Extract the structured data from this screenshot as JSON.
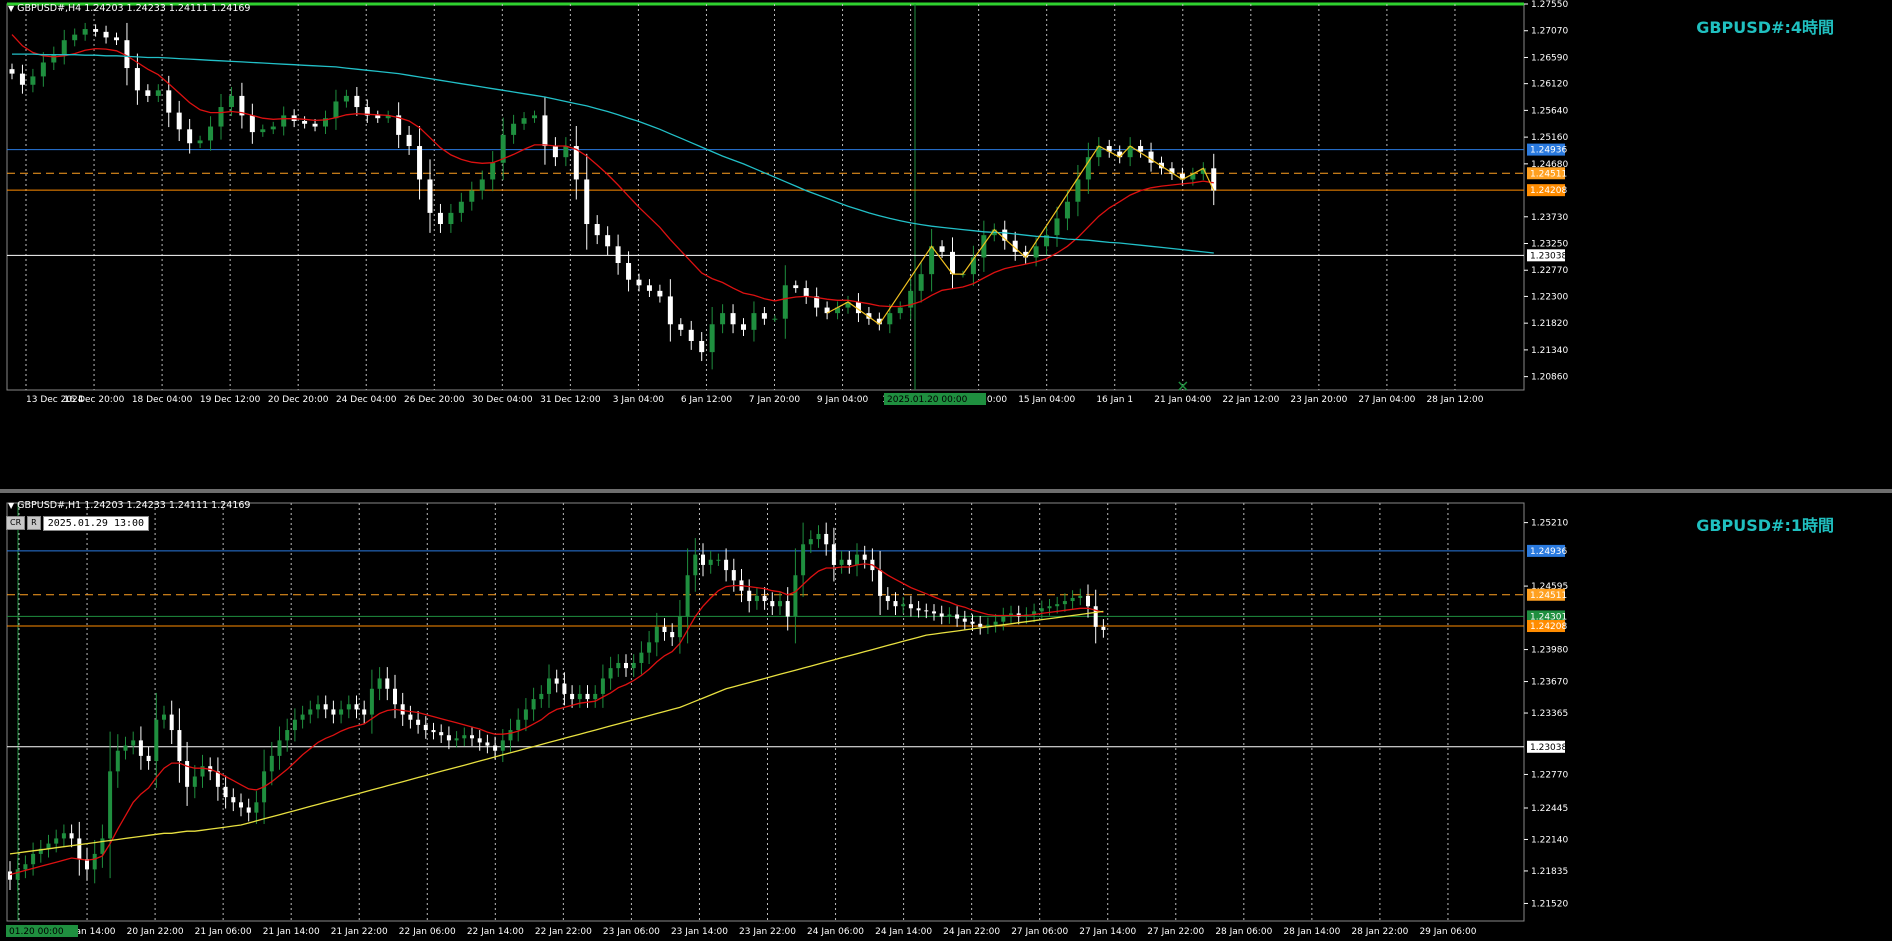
{
  "colors": {
    "background": "#000000",
    "bull": "#1f8f3f",
    "bear": "#ffffff",
    "ma_fast": "#dd1111",
    "ma_slow_h4": "#22c0c8",
    "ma_slow_h1": "#e8e040",
    "zigzag": "#f0c020",
    "line_blue": "#2a7adf",
    "line_orange_dash": "#ffa020",
    "line_orange": "#ff8c00",
    "line_white": "#ffffff",
    "grid": "#bbbbbb",
    "axis_text": "#ffffff",
    "title_text": "#20c0c0"
  },
  "chart_data": [
    {
      "type": "candlestick",
      "title": "GBPUSD#:4時間",
      "info": "GBPUSD#,H4  1.24203 1.24233 1.24111 1.24169",
      "ylim": [
        1.2062,
        1.2755
      ],
      "y_ticks": [
        "1.27550",
        "1.27070",
        "1.26590",
        "1.26120",
        "1.25640",
        "1.25160",
        "1.24680",
        "1.23730",
        "1.23250",
        "1.22770",
        "1.22300",
        "1.21820",
        "1.21340",
        "1.20860"
      ],
      "x_ticks": [
        "13 Dec 2024",
        "16 Dec 20:00",
        "18 Dec 04:00",
        "19 Dec 12:00",
        "20 Dec 20:00",
        "24 Dec 04:00",
        "26 Dec 20:00",
        "30 Dec 04:00",
        "31 Dec 12:00",
        "3 Jan 04:00",
        "6 Jan 12:00",
        "7 Jan 20:00",
        "9 Jan 04:00",
        "10 Jan 12:00",
        "13 Jan 20:00",
        "15 Jan 04:00",
        "16 Jan 1",
        "21 Jan 04:00",
        "22 Jan 12:00",
        "23 Jan 20:00",
        "27 Jan 04:00",
        "28 Jan 12:00"
      ],
      "x_marker": "2025.01.20 00:00",
      "price_lines": [
        {
          "label": "1.24936",
          "value": 1.24936,
          "style": "solid",
          "color": "#2a7adf"
        },
        {
          "label": "1.24511",
          "value": 1.24511,
          "style": "dashed",
          "color": "#ffa020"
        },
        {
          "label": "1.24208",
          "value": 1.24208,
          "style": "solid",
          "color": "#ff8c00"
        },
        {
          "label": "1.23038",
          "value": 1.23038,
          "style": "solid",
          "color": "#ffffff"
        }
      ],
      "close": [
        1.263,
        1.261,
        1.2625,
        1.265,
        1.2665,
        1.269,
        1.27,
        1.271,
        1.2705,
        1.2695,
        1.269,
        1.264,
        1.26,
        1.259,
        1.26,
        1.256,
        1.253,
        1.2505,
        1.251,
        1.2535,
        1.257,
        1.259,
        1.2555,
        1.2525,
        1.253,
        1.2535,
        1.2555,
        1.2545,
        1.254,
        1.2535,
        1.255,
        1.258,
        1.259,
        1.257,
        1.2555,
        1.255,
        1.2555,
        1.252,
        1.25,
        1.244,
        1.238,
        1.236,
        1.238,
        1.24,
        1.242,
        1.244,
        1.247,
        1.252,
        1.254,
        1.255,
        1.2555,
        1.25,
        1.248,
        1.25,
        1.244,
        1.236,
        1.234,
        1.232,
        1.229,
        1.226,
        1.225,
        1.224,
        1.223,
        1.218,
        1.217,
        1.215,
        1.213,
        1.218,
        1.22,
        1.218,
        1.217,
        1.22,
        1.219,
        1.219,
        1.225,
        1.2245,
        1.223,
        1.221,
        1.22,
        1.221,
        1.222,
        1.22,
        1.219,
        1.218,
        1.22,
        1.221,
        1.224,
        1.227,
        1.232,
        1.231,
        1.227,
        1.227,
        1.23,
        1.234,
        1.235,
        1.233,
        1.231,
        1.23,
        1.232,
        1.234,
        1.237,
        1.24,
        1.244,
        1.248,
        1.25,
        1.249,
        1.248,
        1.25,
        1.249,
        1.247,
        1.246,
        1.245,
        1.244,
        1.245,
        1.246,
        1.242
      ],
      "series": [
        {
          "name": "MA fast",
          "values": [
            1.27,
            1.268,
            1.2668,
            1.2662,
            1.266,
            1.2662,
            1.2666,
            1.2672,
            1.2675,
            1.2674,
            1.2671,
            1.2662,
            1.265,
            1.2638,
            1.2628,
            1.2612,
            1.2595,
            1.2578,
            1.2565,
            1.256,
            1.256,
            1.2562,
            1.256,
            1.2555,
            1.255,
            1.2548,
            1.2549,
            1.2549,
            1.2548,
            1.2546,
            1.2547,
            1.2551,
            1.2556,
            1.2558,
            1.2557,
            1.2556,
            1.2555,
            1.2551,
            1.2545,
            1.2533,
            1.2515,
            1.2497,
            1.2484,
            1.2476,
            1.2471,
            1.2469,
            1.247,
            1.2477,
            1.2485,
            1.2494,
            1.2502,
            1.2502,
            1.25,
            1.25,
            1.2494,
            1.2482,
            1.2466,
            1.2449,
            1.243,
            1.241,
            1.239,
            1.2372,
            1.2354,
            1.2332,
            1.2312,
            1.2292,
            1.2272,
            1.2262,
            1.2255,
            1.2245,
            1.2236,
            1.2232,
            1.2226,
            1.2222,
            1.2226,
            1.2229,
            1.223,
            1.2228,
            1.2225,
            1.2223,
            1.2223,
            1.222,
            1.2217,
            1.2213,
            1.2212,
            1.2212,
            1.2215,
            1.2221,
            1.2232,
            1.2241,
            1.2244,
            1.2247,
            1.2253,
            1.2263,
            1.2273,
            1.228,
            1.2284,
            1.2288,
            1.2292,
            1.2298,
            1.2308,
            1.232,
            1.2336,
            1.2355,
            1.2374,
            1.2389,
            1.24,
            1.2412,
            1.242,
            1.2425,
            1.2428,
            1.243,
            1.2432,
            1.2434,
            1.2437,
            1.2434
          ]
        },
        {
          "name": "MA slow",
          "values": [
            1.2665,
            1.2665,
            1.2665,
            1.2664,
            1.2664,
            1.2664,
            1.2664,
            1.2663,
            1.2663,
            1.2662,
            1.2662,
            1.2661,
            1.266,
            1.2659,
            1.2659,
            1.2658,
            1.2657,
            1.2656,
            1.2655,
            1.2654,
            1.2653,
            1.2652,
            1.2651,
            1.265,
            1.2649,
            1.2648,
            1.2647,
            1.2646,
            1.2645,
            1.2644,
            1.2643,
            1.2642,
            1.264,
            1.2638,
            1.2636,
            1.2634,
            1.2632,
            1.263,
            1.2627,
            1.2624,
            1.2621,
            1.2618,
            1.2615,
            1.2612,
            1.2609,
            1.2606,
            1.2603,
            1.26,
            1.2597,
            1.2594,
            1.2591,
            1.2588,
            1.2584,
            1.258,
            1.2576,
            1.2572,
            1.2567,
            1.2562,
            1.2556,
            1.255,
            1.2544,
            1.2537,
            1.253,
            1.2522,
            1.2514,
            1.2506,
            1.2498,
            1.249,
            1.2482,
            1.2475,
            1.2468,
            1.246,
            1.2452,
            1.2444,
            1.2436,
            1.2428,
            1.242,
            1.2413,
            1.2406,
            1.2399,
            1.2392,
            1.2386,
            1.238,
            1.2375,
            1.237,
            1.2366,
            1.2362,
            1.2359,
            1.2356,
            1.2354,
            1.2352,
            1.235,
            1.2348,
            1.2346,
            1.2345,
            1.2344,
            1.2342,
            1.234,
            1.2338,
            1.2337,
            1.2335,
            1.2333,
            1.2332,
            1.2331,
            1.2329,
            1.2327,
            1.2326,
            1.2324,
            1.2322,
            1.232,
            1.2318,
            1.2316,
            1.2314,
            1.2312,
            1.231,
            1.2308
          ]
        }
      ]
    },
    {
      "type": "candlestick",
      "title": "GBPUSD#:1時間",
      "info": "GBPUSD#,H1  1.24203 1.24233 1.24111 1.24169",
      "ylim": [
        1.2135,
        1.254
      ],
      "y_ticks": [
        "1.25210",
        "1.24595",
        "1.23980",
        "1.23670",
        "1.23365",
        "1.22770",
        "1.22445",
        "1.22140",
        "1.21835",
        "1.21520"
      ],
      "x_ticks": [
        "20 Jan 06:00",
        "20 Jan 14:00",
        "20 Jan 22:00",
        "21 Jan 06:00",
        "21 Jan 14:00",
        "21 Jan 22:00",
        "22 Jan 06:00",
        "22 Jan 14:00",
        "22 Jan 22:00",
        "23 Jan 06:00",
        "23 Jan 14:00",
        "23 Jan 22:00",
        "24 Jan 06:00",
        "24 Jan 14:00",
        "24 Jan 22:00",
        "27 Jan 06:00",
        "27 Jan 14:00",
        "27 Jan 22:00",
        "28 Jan 06:00",
        "28 Jan 14:00",
        "28 Jan 22:00",
        "29 Jan 06:00"
      ],
      "x_marker": "01.20 00:00",
      "crosshair_datetime": "2025.01.29 13:00",
      "crosshair_buttons": [
        "CR",
        "R"
      ],
      "price_lines": [
        {
          "label": "1.24936",
          "value": 1.24936,
          "style": "solid",
          "color": "#2a7adf"
        },
        {
          "label": "1.24511",
          "value": 1.24511,
          "style": "dashed",
          "color": "#ffa020"
        },
        {
          "label": "1.24301",
          "value": 1.24301,
          "style": "solid",
          "color": "#1f8f3f"
        },
        {
          "label": "1.24208",
          "value": 1.24208,
          "style": "solid",
          "color": "#ff8c00"
        },
        {
          "label": "1.23038",
          "value": 1.23038,
          "style": "solid",
          "color": "#ffffff"
        }
      ],
      "close": [
        1.2175,
        1.2185,
        1.219,
        1.22,
        1.2205,
        1.221,
        1.2215,
        1.222,
        1.2215,
        1.2195,
        1.2185,
        1.22,
        1.2215,
        1.228,
        1.23,
        1.2305,
        1.231,
        1.2295,
        1.229,
        1.233,
        1.2335,
        1.232,
        1.229,
        1.2265,
        1.2275,
        1.2285,
        1.228,
        1.2265,
        1.2255,
        1.225,
        1.2245,
        1.224,
        1.225,
        1.228,
        1.2295,
        1.231,
        1.232,
        1.233,
        1.2335,
        1.234,
        1.2345,
        1.234,
        1.2335,
        1.234,
        1.2345,
        1.234,
        1.2335,
        1.236,
        1.237,
        1.236,
        1.2345,
        1.2335,
        1.233,
        1.2325,
        1.232,
        1.2318,
        1.2315,
        1.231,
        1.2312,
        1.2315,
        1.2312,
        1.2308,
        1.2305,
        1.23,
        1.231,
        1.232,
        1.233,
        1.234,
        1.235,
        1.2355,
        1.237,
        1.2365,
        1.2355,
        1.235,
        1.2355,
        1.235,
        1.2355,
        1.237,
        1.238,
        1.2385,
        1.238,
        1.2385,
        1.2395,
        1.2405,
        1.242,
        1.2415,
        1.241,
        1.243,
        1.247,
        1.249,
        1.248,
        1.2485,
        1.2485,
        1.2475,
        1.2465,
        1.2455,
        1.2445,
        1.245,
        1.2445,
        1.244,
        1.2445,
        1.243,
        1.247,
        1.25,
        1.2505,
        1.251,
        1.25,
        1.248,
        1.2485,
        1.248,
        1.249,
        1.2485,
        1.2475,
        1.245,
        1.2445,
        1.244,
        1.2442,
        1.2438,
        1.2436,
        1.2435,
        1.2433,
        1.243,
        1.2432,
        1.2428,
        1.2425,
        1.2423,
        1.242,
        1.2422,
        1.2425,
        1.243,
        1.2433,
        1.243,
        1.2432,
        1.2435,
        1.2438,
        1.244,
        1.2442,
        1.2445,
        1.2448,
        1.245,
        1.244,
        1.242,
        1.2417
      ],
      "series": [
        {
          "name": "MA fast",
          "values": [
            1.218,
            1.2182,
            1.2184,
            1.2186,
            1.2188,
            1.219,
            1.2192,
            1.2194,
            1.2196,
            1.2195,
            1.2194,
            1.2195,
            1.2198,
            1.221,
            1.2224,
            1.2237,
            1.225,
            1.2258,
            1.2264,
            1.2274,
            1.2283,
            1.2288,
            1.2288,
            1.2285,
            1.2283,
            1.2283,
            1.2282,
            1.2279,
            1.2275,
            1.2271,
            1.2267,
            1.2263,
            1.2262,
            1.2265,
            1.227,
            1.2276,
            1.2282,
            1.2289,
            1.2296,
            1.2302,
            1.2308,
            1.2312,
            1.2315,
            1.2319,
            1.2322,
            1.2324,
            1.2326,
            1.2331,
            1.2336,
            1.2339,
            1.234,
            1.2339,
            1.2338,
            1.2337,
            1.2335,
            1.2333,
            1.2331,
            1.2329,
            1.2327,
            1.2325,
            1.2323,
            1.2321,
            1.2318,
            1.2316,
            1.2316,
            1.2317,
            1.2319,
            1.2322,
            1.2326,
            1.233,
            1.2336,
            1.234,
            1.2342,
            1.2344,
            1.2346,
            1.2347,
            1.2348,
            1.2352,
            1.2356,
            1.2361,
            1.2364,
            1.2368,
            1.2373,
            1.2379,
            1.2386,
            1.2392,
            1.2396,
            1.2404,
            1.2417,
            1.243,
            1.244,
            1.2448,
            1.2455,
            1.2459,
            1.246,
            1.246,
            1.2459,
            1.2458,
            1.2457,
            1.2455,
            1.2454,
            1.2451,
            1.2454,
            1.2461,
            1.2468,
            1.2474,
            1.2477,
            1.2477,
            1.2478,
            1.2478,
            1.248,
            1.2481,
            1.248,
            1.2475,
            1.247,
            1.2466,
            1.2462,
            1.2458,
            1.2455,
            1.2452,
            1.2449,
            1.2446,
            1.2444,
            1.2441,
            1.2439,
            1.2436,
            1.2434,
            1.2432,
            1.2431,
            1.2431,
            1.2431,
            1.2431,
            1.2431,
            1.2432,
            1.2433,
            1.2434,
            1.2435,
            1.2436,
            1.2437,
            1.2438,
            1.2438,
            1.2436,
            1.2434
          ]
        },
        {
          "name": "MA slow",
          "values": [
            1.22,
            1.2201,
            1.2202,
            1.2203,
            1.2204,
            1.2205,
            1.2206,
            1.2207,
            1.2208,
            1.2209,
            1.221,
            1.2211,
            1.2212,
            1.2213,
            1.2214,
            1.2215,
            1.2216,
            1.2217,
            1.2218,
            1.2219,
            1.222,
            1.222,
            1.2221,
            1.2222,
            1.2222,
            1.2223,
            1.2224,
            1.2225,
            1.2226,
            1.2227,
            1.2228,
            1.223,
            1.2232,
            1.2234,
            1.2236,
            1.2238,
            1.224,
            1.2242,
            1.2244,
            1.2246,
            1.2248,
            1.225,
            1.2252,
            1.2254,
            1.2256,
            1.2258,
            1.226,
            1.2262,
            1.2264,
            1.2266,
            1.2268,
            1.227,
            1.2272,
            1.2274,
            1.2276,
            1.2278,
            1.228,
            1.2282,
            1.2284,
            1.2286,
            1.2288,
            1.229,
            1.2292,
            1.2294,
            1.2296,
            1.2298,
            1.23,
            1.2302,
            1.2304,
            1.2306,
            1.2308,
            1.231,
            1.2312,
            1.2314,
            1.2316,
            1.2318,
            1.232,
            1.2322,
            1.2324,
            1.2326,
            1.2328,
            1.233,
            1.2332,
            1.2334,
            1.2336,
            1.2338,
            1.234,
            1.2342,
            1.2345,
            1.2348,
            1.2351,
            1.2354,
            1.2357,
            1.236,
            1.2362,
            1.2364,
            1.2366,
            1.2368,
            1.237,
            1.2372,
            1.2374,
            1.2376,
            1.2378,
            1.238,
            1.2382,
            1.2384,
            1.2386,
            1.2388,
            1.239,
            1.2392,
            1.2394,
            1.2396,
            1.2398,
            1.24,
            1.2402,
            1.2404,
            1.2406,
            1.2408,
            1.241,
            1.2412,
            1.2413,
            1.2414,
            1.2415,
            1.2416,
            1.2417,
            1.2418,
            1.2419,
            1.242,
            1.2421,
            1.2422,
            1.2423,
            1.2424,
            1.2425,
            1.2426,
            1.2427,
            1.2428,
            1.2429,
            1.243,
            1.2431,
            1.2432,
            1.2433,
            1.2434,
            1.2435
          ]
        }
      ]
    }
  ]
}
